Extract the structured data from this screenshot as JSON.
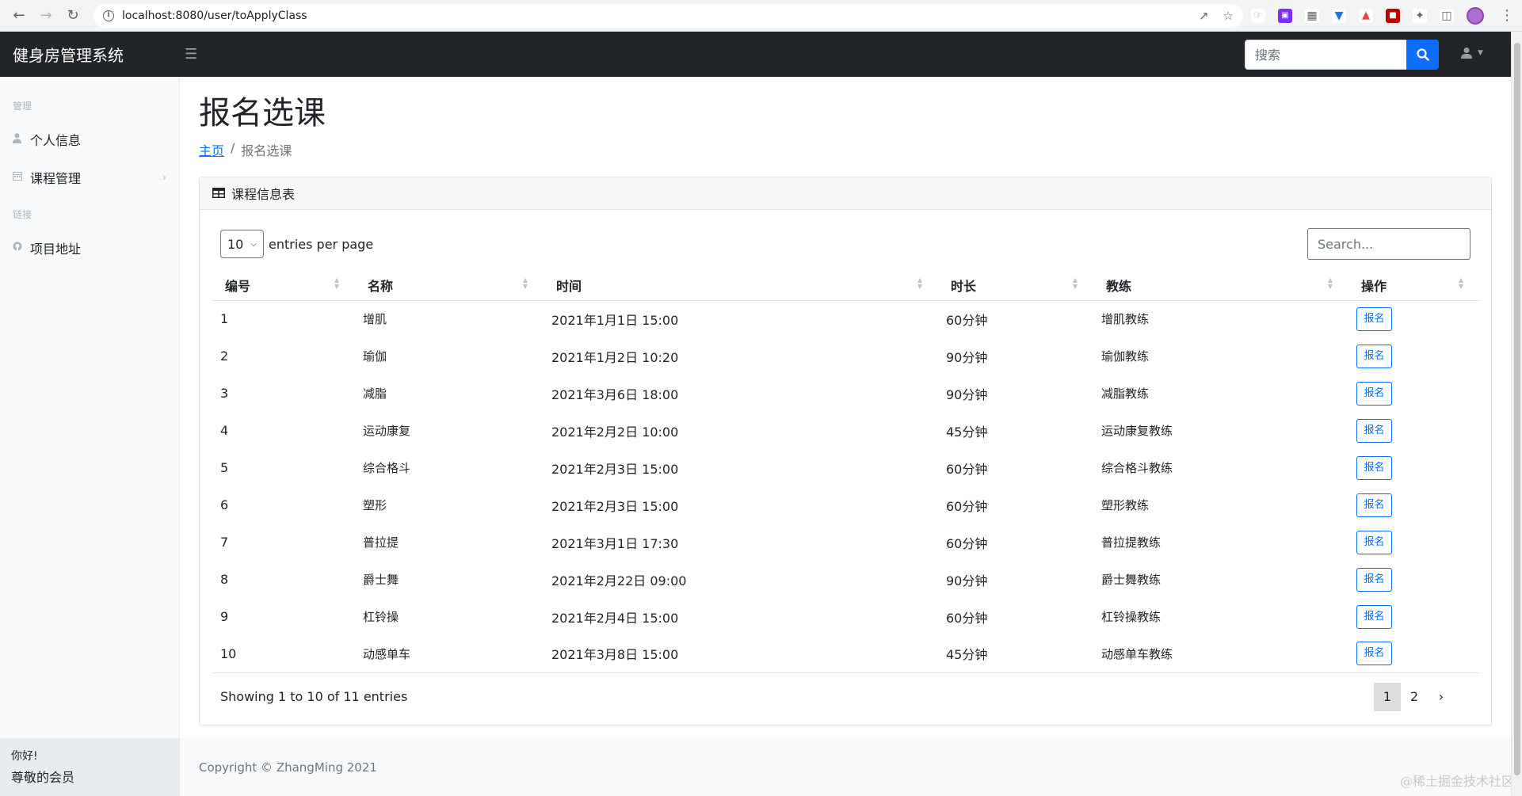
{
  "browser": {
    "url": "localhost:8080/user/toApplyClass"
  },
  "navbar": {
    "brand": "健身房管理系统",
    "search_placeholder": "搜索"
  },
  "sidebar": {
    "section_manage": "管理",
    "items_manage": [
      {
        "label": "个人信息",
        "icon": "user-icon"
      },
      {
        "label": "课程管理",
        "icon": "calendar-icon"
      }
    ],
    "section_links": "链接",
    "items_links": [
      {
        "label": "项目地址",
        "icon": "github-icon"
      }
    ],
    "footer_greeting": "你好!",
    "footer_role": "尊敬的会员"
  },
  "page": {
    "title": "报名选课",
    "breadcrumb_home": "主页",
    "breadcrumb_current": "报名选课"
  },
  "card": {
    "title": "课程信息表"
  },
  "datatable": {
    "per_page_value": "10",
    "per_page_label": "entries per page",
    "search_placeholder": "Search...",
    "columns": [
      "编号",
      "名称",
      "时间",
      "时长",
      "教练",
      "操作"
    ],
    "rows": [
      {
        "id": "1",
        "name": "增肌",
        "time": "2021年1月1日 15:00",
        "duration": "60分钟",
        "coach": "增肌教练",
        "action": "报名"
      },
      {
        "id": "2",
        "name": "瑜伽",
        "time": "2021年1月2日 10:20",
        "duration": "90分钟",
        "coach": "瑜伽教练",
        "action": "报名"
      },
      {
        "id": "3",
        "name": "减脂",
        "time": "2021年3月6日 18:00",
        "duration": "90分钟",
        "coach": "减脂教练",
        "action": "报名"
      },
      {
        "id": "4",
        "name": "运动康复",
        "time": "2021年2月2日 10:00",
        "duration": "45分钟",
        "coach": "运动康复教练",
        "action": "报名"
      },
      {
        "id": "5",
        "name": "综合格斗",
        "time": "2021年2月3日 15:00",
        "duration": "60分钟",
        "coach": "综合格斗教练",
        "action": "报名"
      },
      {
        "id": "6",
        "name": "塑形",
        "time": "2021年2月3日 15:00",
        "duration": "60分钟",
        "coach": "塑形教练",
        "action": "报名"
      },
      {
        "id": "7",
        "name": "普拉提",
        "time": "2021年3月1日 17:30",
        "duration": "60分钟",
        "coach": "普拉提教练",
        "action": "报名"
      },
      {
        "id": "8",
        "name": "爵士舞",
        "time": "2021年2月22日 09:00",
        "duration": "90分钟",
        "coach": "爵士舞教练",
        "action": "报名"
      },
      {
        "id": "9",
        "name": "杠铃操",
        "time": "2021年2月4日 15:00",
        "duration": "60分钟",
        "coach": "杠铃操教练",
        "action": "报名"
      },
      {
        "id": "10",
        "name": "动感单车",
        "time": "2021年3月8日 15:00",
        "duration": "45分钟",
        "coach": "动感单车教练",
        "action": "报名"
      }
    ],
    "info": "Showing 1 to 10 of 11 entries",
    "pages": [
      "1",
      "2"
    ],
    "next_label": "›",
    "current_page": "1"
  },
  "footer": {
    "copyright": "Copyright © ZhangMing 2021"
  },
  "watermark": "@稀土掘金技术社区",
  "colors": {
    "navbar_bg": "#212529",
    "primary": "#0d6efd",
    "sidebar_bg": "#f8f9fa"
  }
}
